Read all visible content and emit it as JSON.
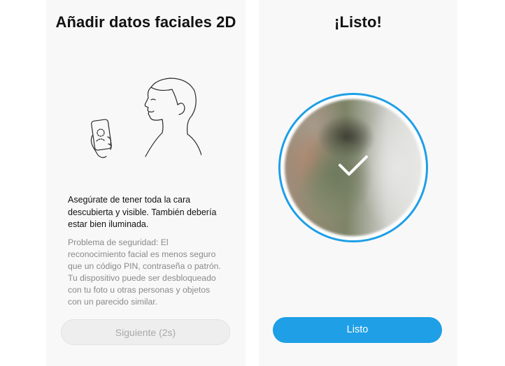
{
  "left_screen": {
    "title": "Añadir datos faciales 2D",
    "illustration_icon": "face-scan-illustration-icon",
    "instructions": "Asegúrate de tener toda la cara descubierta y visible. También debería estar bien iluminada.",
    "security_warning": "Problema de seguridad: El reconocimiento facial es menos seguro que un código PIN, contraseña o patrón. Tu dispositivo puede ser desbloqueado con tu foto u otras personas y objetos con un parecido similar.",
    "next_button_label": "Siguiente (2s)",
    "next_button_enabled": false
  },
  "right_screen": {
    "title": "¡Listo!",
    "check_icon": "checkmark-icon",
    "done_button_label": "Listo"
  },
  "colors": {
    "accent": "#1e9fe6",
    "panel_background": "#f8f8f8",
    "disabled_button": "#eeeeee",
    "disabled_text": "#a8a8a8",
    "warning_text": "#8a8a8a"
  }
}
